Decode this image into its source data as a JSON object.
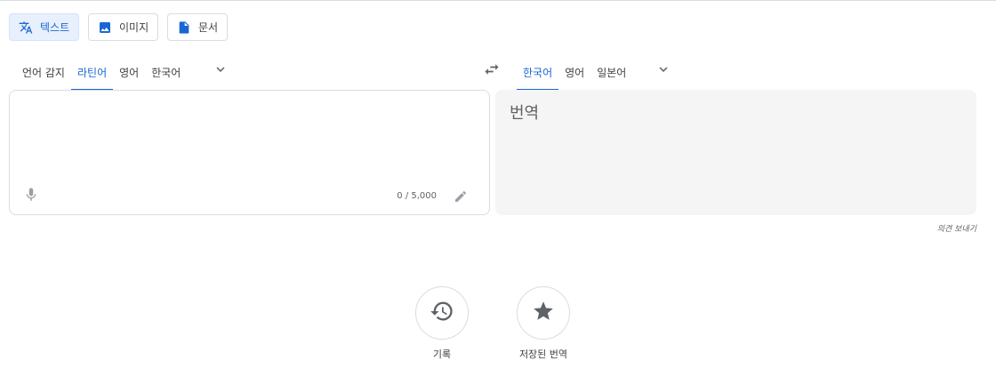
{
  "modes": [
    {
      "label": "텍스트",
      "icon": "translate-icon",
      "active": true
    },
    {
      "label": "이미지",
      "icon": "image-icon",
      "active": false
    },
    {
      "label": "문서",
      "icon": "document-icon",
      "active": false
    }
  ],
  "source_langs": [
    "언어 감지",
    "라틴어",
    "영어",
    "한국어"
  ],
  "source_active": "라틴어",
  "target_langs": [
    "한국어",
    "영어",
    "일본어"
  ],
  "target_active": "한국어",
  "source": {
    "text": "",
    "counter": "0 / 5,000"
  },
  "target": {
    "placeholder": "번역"
  },
  "feedback": "의견 보내기",
  "bottom": {
    "history": "기록",
    "saved": "저장된 번역"
  },
  "colors": {
    "accent": "#1967d2",
    "border": "#dadce0",
    "panel_bg": "#f5f5f5"
  }
}
